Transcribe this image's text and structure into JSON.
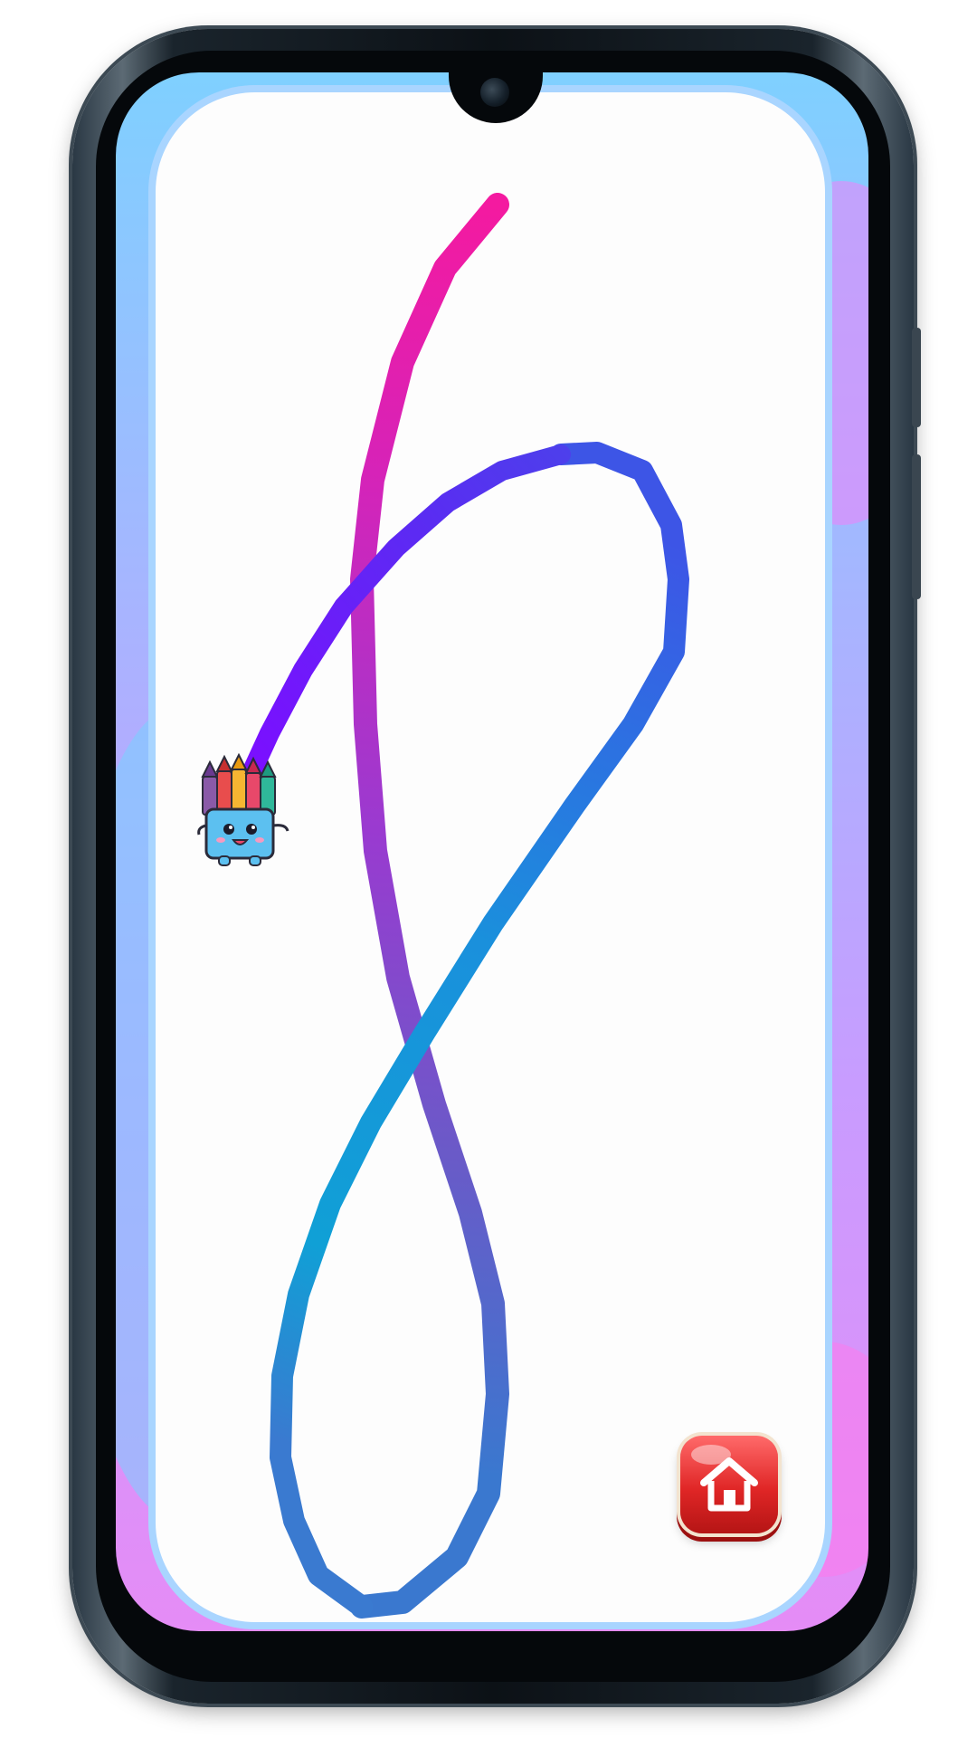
{
  "app": {
    "screen_background": "#b0b6ff",
    "canvas_color": "#fdfdfd",
    "canvas_border_color": "#a9d5ff"
  },
  "drawing": {
    "stroke_gradient_start": "#ee1aa4",
    "stroke_gradient_mid": "#7a3ff0",
    "stroke_gradient_end": "#2b8ad8",
    "tool": "crayon-box-mascot-icon"
  },
  "controls": {
    "home_button": {
      "icon": "home-icon",
      "color": "#e02626"
    }
  }
}
